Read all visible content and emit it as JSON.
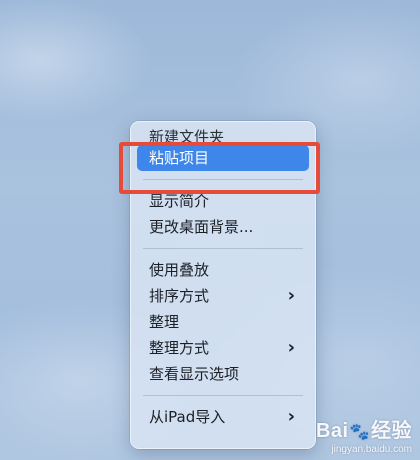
{
  "context_menu": {
    "items": [
      {
        "label": "新建文件夹"
      },
      {
        "label": "粘贴项目"
      },
      {
        "label": "显示简介"
      },
      {
        "label": "更改桌面背景..."
      },
      {
        "label": "使用叠放"
      },
      {
        "label": "排序方式"
      },
      {
        "label": "整理"
      },
      {
        "label": "整理方式"
      },
      {
        "label": "查看显示选项"
      },
      {
        "label": "从iPad导入"
      }
    ],
    "selected_item": "粘贴项目"
  },
  "watermark": {
    "brand_left": "Bai",
    "brand_right": "经验",
    "url": "jingyan.baidu.com"
  },
  "colors": {
    "selection": "#3f86ea",
    "highlight_box": "#e64a3a"
  }
}
